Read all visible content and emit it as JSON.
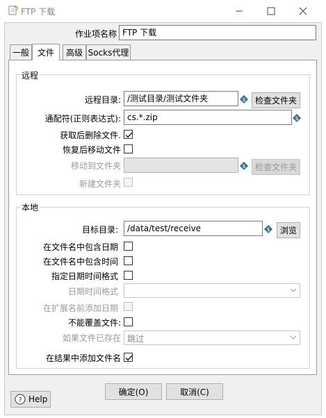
{
  "window": {
    "title": "FTP 下载",
    "controls": {
      "minimize": "minimize-icon",
      "maximize": "maximize-icon",
      "close": "close-icon"
    }
  },
  "job": {
    "name_label": "作业项名称",
    "name_value": "FTP 下载"
  },
  "tabs": [
    {
      "label": "一般",
      "active": false
    },
    {
      "label": "文件",
      "active": true
    },
    {
      "label": "高级",
      "active": false
    },
    {
      "label": "Socks代理",
      "active": false
    }
  ],
  "remote": {
    "group_title": "远程",
    "dir_label": "远程目录:",
    "dir_value": "/测试目录/测试文件夹",
    "check_folder_button": "检查文件夹",
    "wildcard_label": "通配符(正则表达式):",
    "wildcard_value": "cs.*.zip",
    "delete_after_label": "获取后删除文件.",
    "delete_after_checked": true,
    "move_after_label": "恢复后移动文件",
    "move_after_checked": false,
    "move_to_label": "移动到文件夹",
    "move_to_value": "",
    "check_folder_button_2": "检查文件夹",
    "create_folder_label": "新建文件夹",
    "create_folder_checked": false
  },
  "local": {
    "group_title": "本地",
    "target_label": "目标目录:",
    "target_value": "/data/test/receive",
    "browse_button": "浏览",
    "include_date_label": "在文件名中包含日期",
    "include_date_checked": false,
    "include_time_label": "在文件名中包含时间",
    "include_time_checked": false,
    "specify_format_label": "指定日期时间格式",
    "specify_format_checked": false,
    "datetime_format_label": "日期时间格式",
    "datetime_format_value": "",
    "add_date_before_ext_label": "在扩展名前添加日期",
    "add_date_before_ext_checked": false,
    "no_overwrite_label": "不能覆盖文件:",
    "no_overwrite_checked": false,
    "if_exists_label": "如果文件已存在",
    "if_exists_value": "跳过",
    "add_to_result_label": "在结果中添加文件名",
    "add_to_result_checked": true
  },
  "footer": {
    "ok_button": "确定(O)",
    "cancel_button": "取消(C)",
    "help_button": "Help"
  },
  "colors": {
    "variable_icon": "#2e6f8e",
    "frame_bg": "#f0f0f0",
    "panel_bg": "#ffffff"
  }
}
